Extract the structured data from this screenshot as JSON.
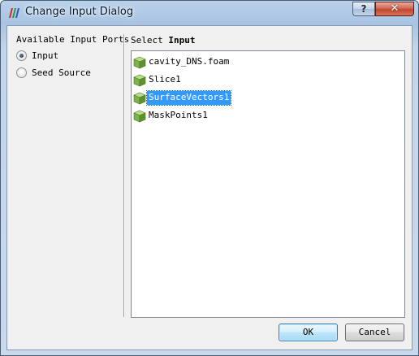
{
  "window": {
    "title": "Change Input Dialog",
    "help_label": "?",
    "close_label": "✕"
  },
  "ports": {
    "heading": "Available Input Ports",
    "options": [
      {
        "label": "Input",
        "checked": true
      },
      {
        "label": "Seed Source",
        "checked": false
      }
    ]
  },
  "select": {
    "prefix": "Select ",
    "port_name": "Input"
  },
  "tree": {
    "items": [
      {
        "label": "cavity_DNS.foam",
        "selected": false
      },
      {
        "label": "Slice1",
        "selected": false
      },
      {
        "label": "SurfaceVectors1",
        "selected": true
      },
      {
        "label": "MaskPoints1",
        "selected": false
      }
    ]
  },
  "buttons": {
    "ok_label": "OK",
    "cancel_label": "Cancel"
  },
  "colors": {
    "selection": "#3399ff",
    "cube_green": "#7fb24a"
  }
}
